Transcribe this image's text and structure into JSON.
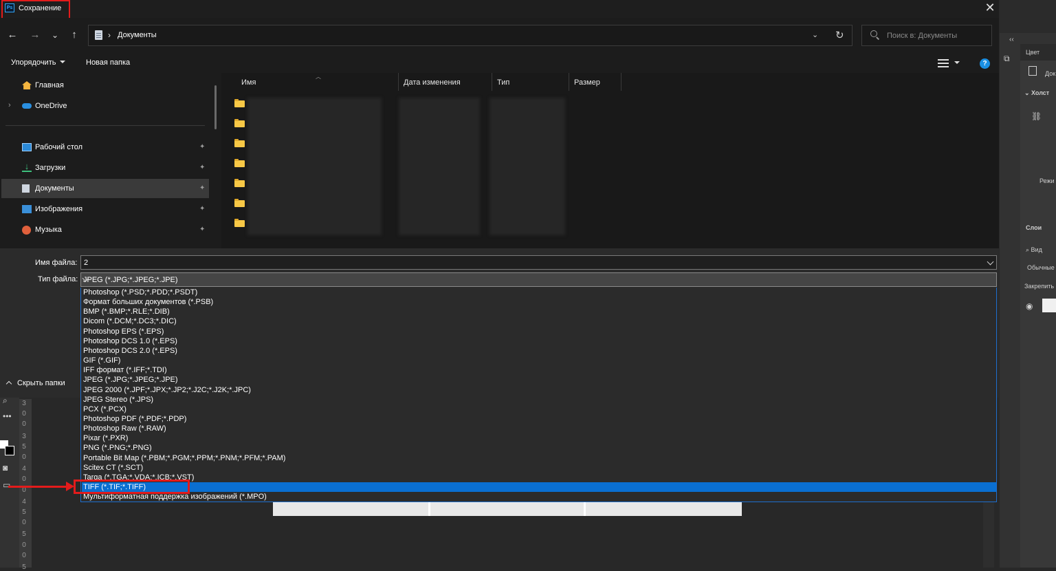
{
  "dialog": {
    "title": "Сохранение",
    "app_logo": "Ps",
    "close": "✕"
  },
  "nav": {
    "back": "←",
    "forward": "→",
    "recent": "⌄",
    "up": "↑",
    "breadcrumb_sep": "›",
    "location": "Документы",
    "refresh": "↻",
    "search_placeholder": "Поиск в: Документы"
  },
  "commands": {
    "organize": "Упорядочить",
    "new_folder": "Новая папка",
    "help": "?"
  },
  "sidebar": {
    "items": [
      {
        "label": "Главная",
        "icon": "home-icon",
        "pinned": false
      },
      {
        "label": "OneDrive",
        "icon": "cloud-icon",
        "pinned": false,
        "expandable": true
      },
      {
        "label": "Рабочий стол",
        "icon": "desktop-icon",
        "pinned": true
      },
      {
        "label": "Загрузки",
        "icon": "download-icon",
        "pinned": true
      },
      {
        "label": "Документы",
        "icon": "documents-icon",
        "pinned": true,
        "selected": true
      },
      {
        "label": "Изображения",
        "icon": "pictures-icon",
        "pinned": true
      },
      {
        "label": "Музыка",
        "icon": "music-icon",
        "pinned": true
      }
    ],
    "pin_glyph": "📌"
  },
  "filelist": {
    "columns": [
      "Имя",
      "Дата изменения",
      "Тип",
      "Размер"
    ],
    "folder_count": 7
  },
  "form": {
    "filename_label": "Имя файла:",
    "filename_value": "2",
    "filetype_label": "Тип файла:",
    "filetype_value": "JPEG (*.JPG;*.JPEG;*.JPE)",
    "hide_folders": "Скрыть папки"
  },
  "filetypes": [
    "Photoshop (*.PSD;*.PDD;*.PSDT)",
    "Формат больших документов (*.PSB)",
    "BMP (*.BMP;*.RLE;*.DIB)",
    "Dicom (*.DCM;*.DC3;*.DIC)",
    "Photoshop EPS (*.EPS)",
    "Photoshop DCS 1.0 (*.EPS)",
    "Photoshop DCS 2.0 (*.EPS)",
    "GIF (*.GIF)",
    "IFF формат (*.IFF;*.TDI)",
    "JPEG (*.JPG;*.JPEG;*.JPE)",
    "JPEG 2000 (*.JPF;*.JPX;*.JP2;*.J2C;*.J2K;*.JPC)",
    "JPEG Stereo (*.JPS)",
    "PCX (*.PCX)",
    "Photoshop PDF (*.PDF;*.PDP)",
    "Photoshop Raw (*.RAW)",
    "Pixar (*.PXR)",
    "PNG (*.PNG;*.PNG)",
    "Portable Bit Map (*.PBM;*.PGM;*.PPM;*.PNM;*.PFM;*.PAM)",
    "Scitex CT (*.SCT)",
    "Targa (*.TGA;*.VDA;*.ICB;*.VST)",
    "TIFF (*.TIF;*.TIFF)",
    "Мультиформатная поддержка изображений  (*.MPO)"
  ],
  "selected_filetype_index": 20,
  "photoshop": {
    "panel_color_tab": "Цвет",
    "panel_canvas": "Холст",
    "panel_layers_tab": "Слои",
    "panel_view": "Вид",
    "panel_normal": "Обычные",
    "panel_lock": "Закрепить",
    "panel_mode": "Режи",
    "panel_doc": "Док",
    "ruler_digits": [
      "3",
      "0",
      "0",
      "3",
      "5",
      "0",
      "4",
      "0",
      "0",
      "4",
      "5",
      "0",
      "5",
      "0",
      "0",
      "5"
    ]
  },
  "colors": {
    "accent": "#0a6fd1",
    "annotation": "#e31b1b",
    "folder": "#f8c846"
  }
}
